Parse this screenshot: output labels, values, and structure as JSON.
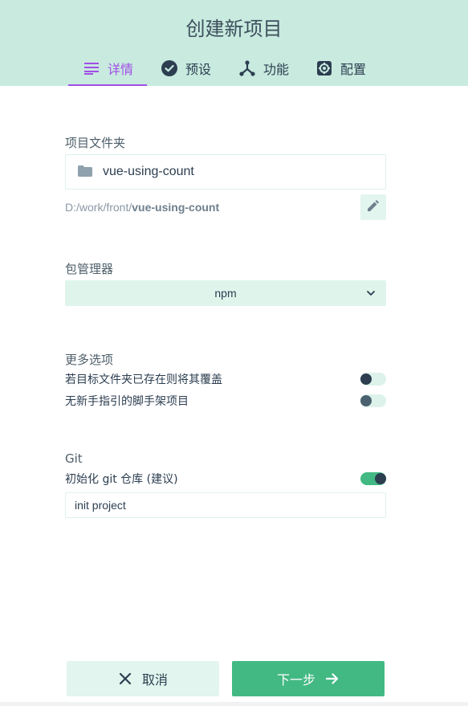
{
  "header": {
    "title": "创建新项目",
    "tabs": [
      {
        "label": "详情",
        "icon": "details-list-icon",
        "active": true
      },
      {
        "label": "预设",
        "icon": "check-circle-icon",
        "active": false
      },
      {
        "label": "功能",
        "icon": "fork-icon",
        "active": false
      },
      {
        "label": "配置",
        "icon": "gear-icon",
        "active": false
      }
    ]
  },
  "folder": {
    "label": "项目文件夹",
    "value": "vue-using-count",
    "path_prefix": "D:/work/front/",
    "path_name": "vue-using-count"
  },
  "package_manager": {
    "label": "包管理器",
    "selected": "npm"
  },
  "more_options": {
    "label": "更多选项",
    "items": [
      {
        "label": "若目标文件夹已存在则将其覆盖",
        "enabled": false
      },
      {
        "label": "无新手指引的脚手架项目",
        "enabled": false
      }
    ]
  },
  "git": {
    "label": "Git",
    "init_label": "初始化 git 仓库 (建议)",
    "init_enabled": true,
    "commit_message": "init project"
  },
  "actions": {
    "cancel_label": "取消",
    "next_label": "下一步"
  },
  "colors": {
    "header_bg": "#c8eadf",
    "accent_purple": "#a14ee6",
    "primary_green": "#42b983",
    "light_green": "#e2f5ee",
    "text_dark": "#2c3e50"
  }
}
